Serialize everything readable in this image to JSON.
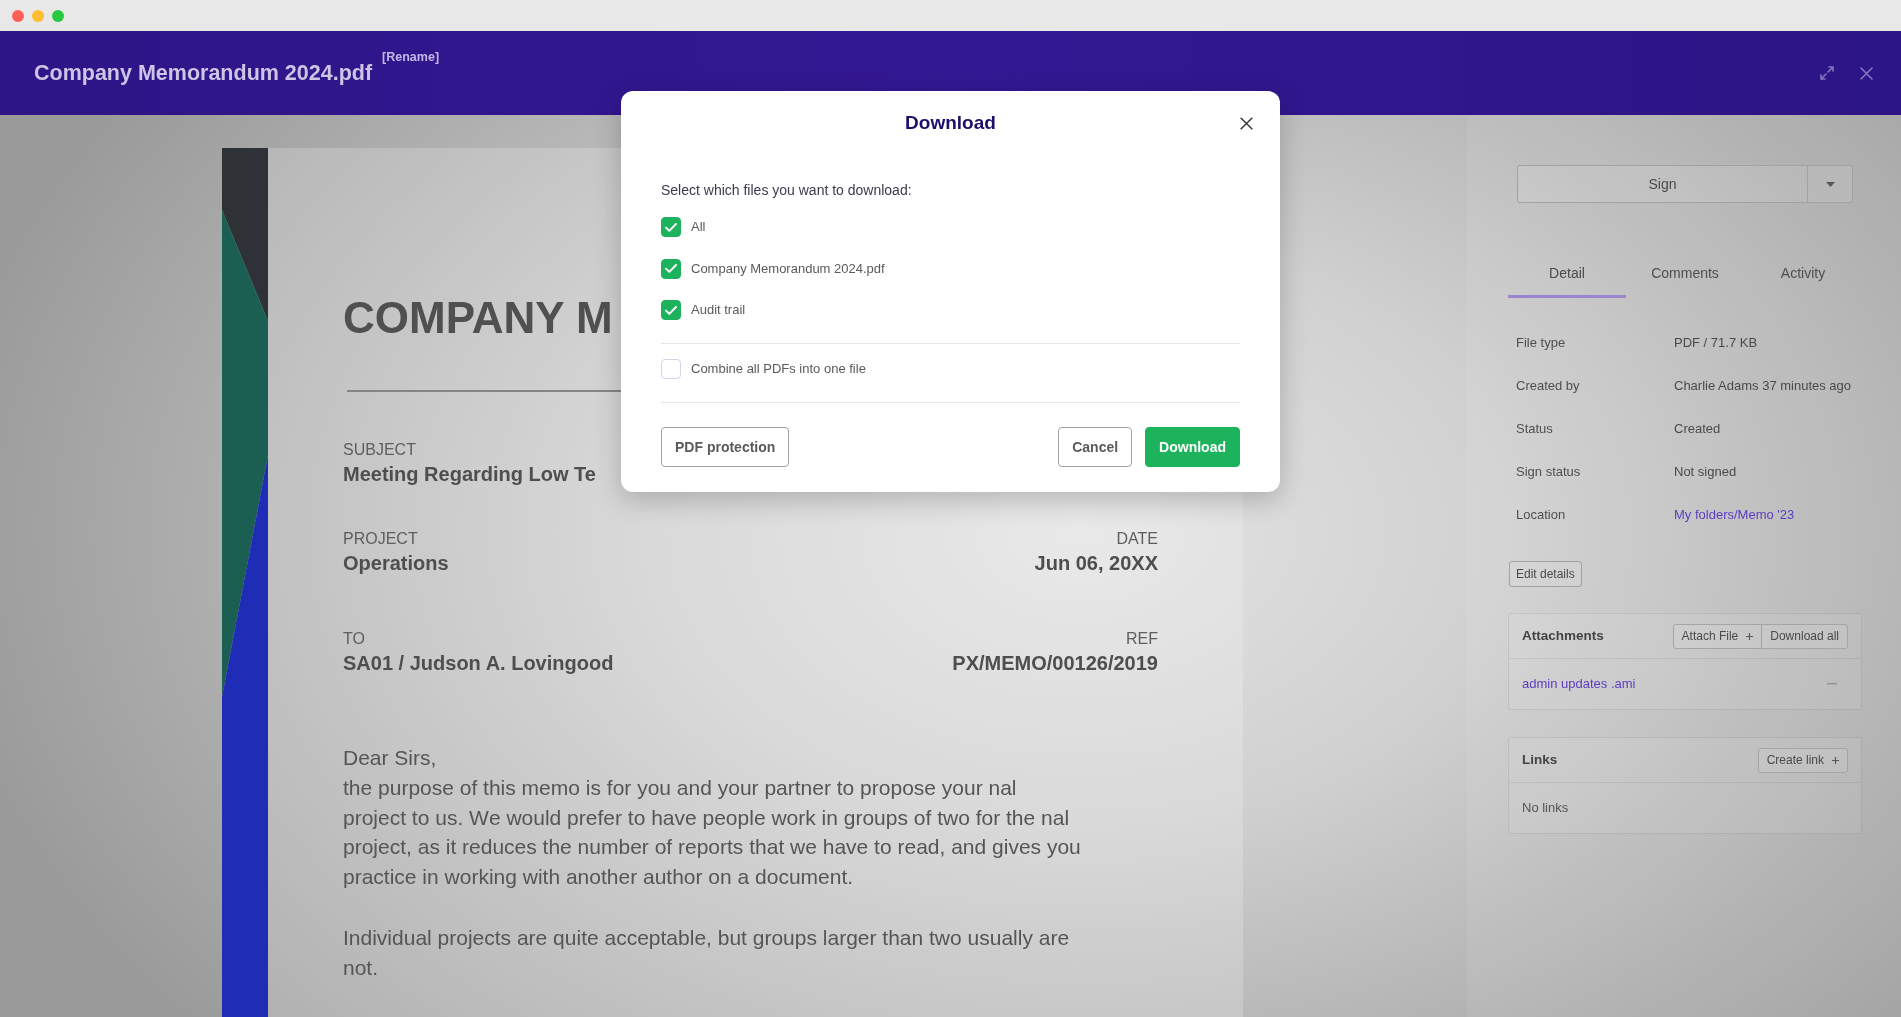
{
  "header": {
    "title": "Company Memorandum 2024.pdf",
    "rename": "[Rename]"
  },
  "document": {
    "heading": "COMPANY M",
    "subject": {
      "label": "SUBJECT",
      "value": "Meeting Regarding Low Te"
    },
    "meta_rows": [
      [
        {
          "label": "PROJECT",
          "value": "Operations"
        },
        {
          "label": "DATE",
          "value": "Jun 06, 20XX"
        }
      ],
      [
        {
          "label": "TO",
          "value": "SA01 / Judson A. Lovingood"
        },
        {
          "label": "REF",
          "value": "PX/MEMO/00126/2019"
        }
      ]
    ],
    "salutation": "Dear Sirs,",
    "paragraphs": [
      "the purpose of this memo is for you and your partner to propose your nal project to us. We would prefer to have people work in groups of two for the nal project, as it reduces the number of reports that we have to read, and gives you practice in working with another author on a document.",
      "Individual projects are quite acceptable, but groups larger than two usually are not."
    ]
  },
  "sidebar": {
    "sign_button": "Sign",
    "tabs": [
      {
        "label": "Detail",
        "selected": true
      },
      {
        "label": "Comments",
        "selected": false
      },
      {
        "label": "Activity",
        "selected": false
      }
    ],
    "details": [
      {
        "label": "File type",
        "value": "PDF / 71.7 KB",
        "kind": "text"
      },
      {
        "label": "Created by",
        "value": "Charlie Adams 37 minutes ago",
        "kind": "text"
      },
      {
        "label": "Status",
        "value": "Created",
        "kind": "text"
      },
      {
        "label": "Sign status",
        "value": "Not signed",
        "kind": "text"
      },
      {
        "label": "Location",
        "value": "My folders/Memo '23",
        "kind": "link"
      }
    ],
    "edit_button": "Edit details",
    "attachments": {
      "title": "Attachments",
      "buttons": [
        {
          "label": "Attach File",
          "kind": "add"
        },
        {
          "label": "Download all",
          "kind": "plain"
        }
      ],
      "items": [
        "admin updates .ami"
      ]
    },
    "links": {
      "title": "Links",
      "button": {
        "label": "Create link",
        "kind": "add"
      },
      "empty_text": "No links"
    }
  },
  "dialog": {
    "title": "Download",
    "prompt": "Select which files you want to download:",
    "files": [
      {
        "label": "All",
        "checked": true
      },
      {
        "label": "Company Memorandum 2024.pdf",
        "checked": true
      },
      {
        "label": "Audit trail",
        "checked": true
      }
    ],
    "options": [
      {
        "label": "Combine all PDFs into one file",
        "checked": false
      }
    ],
    "buttons_left": [
      {
        "label": "PDF protection",
        "kind": "secondary"
      }
    ],
    "buttons_right": [
      {
        "label": "Cancel",
        "kind": "secondary"
      },
      {
        "label": "Download",
        "kind": "primary"
      }
    ]
  }
}
